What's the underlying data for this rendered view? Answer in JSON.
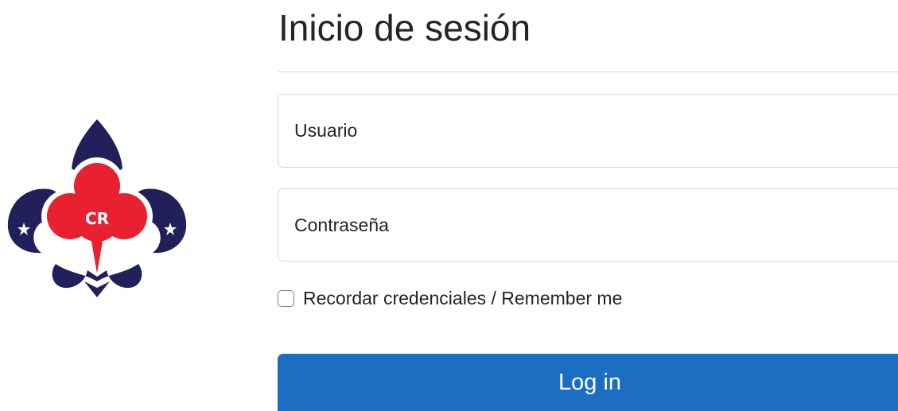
{
  "login": {
    "title": "Inicio de sesión",
    "username_placeholder": "Usuario",
    "password_placeholder": "Contraseña",
    "remember_label": "Recordar credenciales / Remember me",
    "submit_label": "Log in"
  },
  "logo": {
    "monogram": "CR",
    "icon": "fleur-de-lis-scout-emblem-icon",
    "colors": {
      "navy": "#21205b",
      "red": "#e8202f",
      "white": "#ffffff"
    }
  },
  "theme": {
    "primary": "#1b6ec2",
    "text": "#212529",
    "border": "#d5d9dd"
  }
}
